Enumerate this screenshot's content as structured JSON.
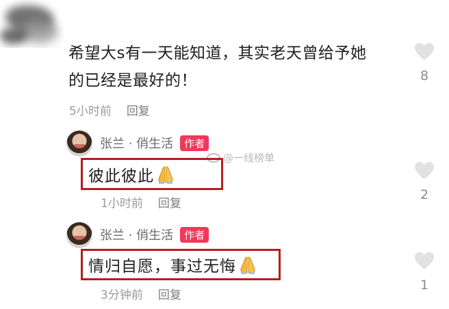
{
  "top_comment": {
    "line1": "希望大s有一天能知道，其实老天曾给予她",
    "line2": "的已经是最好的！",
    "time": "5小时前",
    "reply_label": "回复",
    "likes": "8"
  },
  "replies": [
    {
      "author": "张兰 · 俏生活",
      "badge": "作者",
      "text": "彼此彼此",
      "emoji": "praying-hands",
      "time": "1小时前",
      "reply_label": "回复",
      "likes": "2"
    },
    {
      "author": "张兰 · 俏生活",
      "badge": "作者",
      "text": "情归自愿，事过无悔",
      "emoji": "praying-hands",
      "time": "3分钟前",
      "reply_label": "回复",
      "likes": "1"
    }
  ],
  "watermark": {
    "text": "@一线榜单"
  },
  "colors": {
    "badge": "#f2375a",
    "highlight_box": "#b71c1c",
    "heart": "#e2e2e2"
  }
}
